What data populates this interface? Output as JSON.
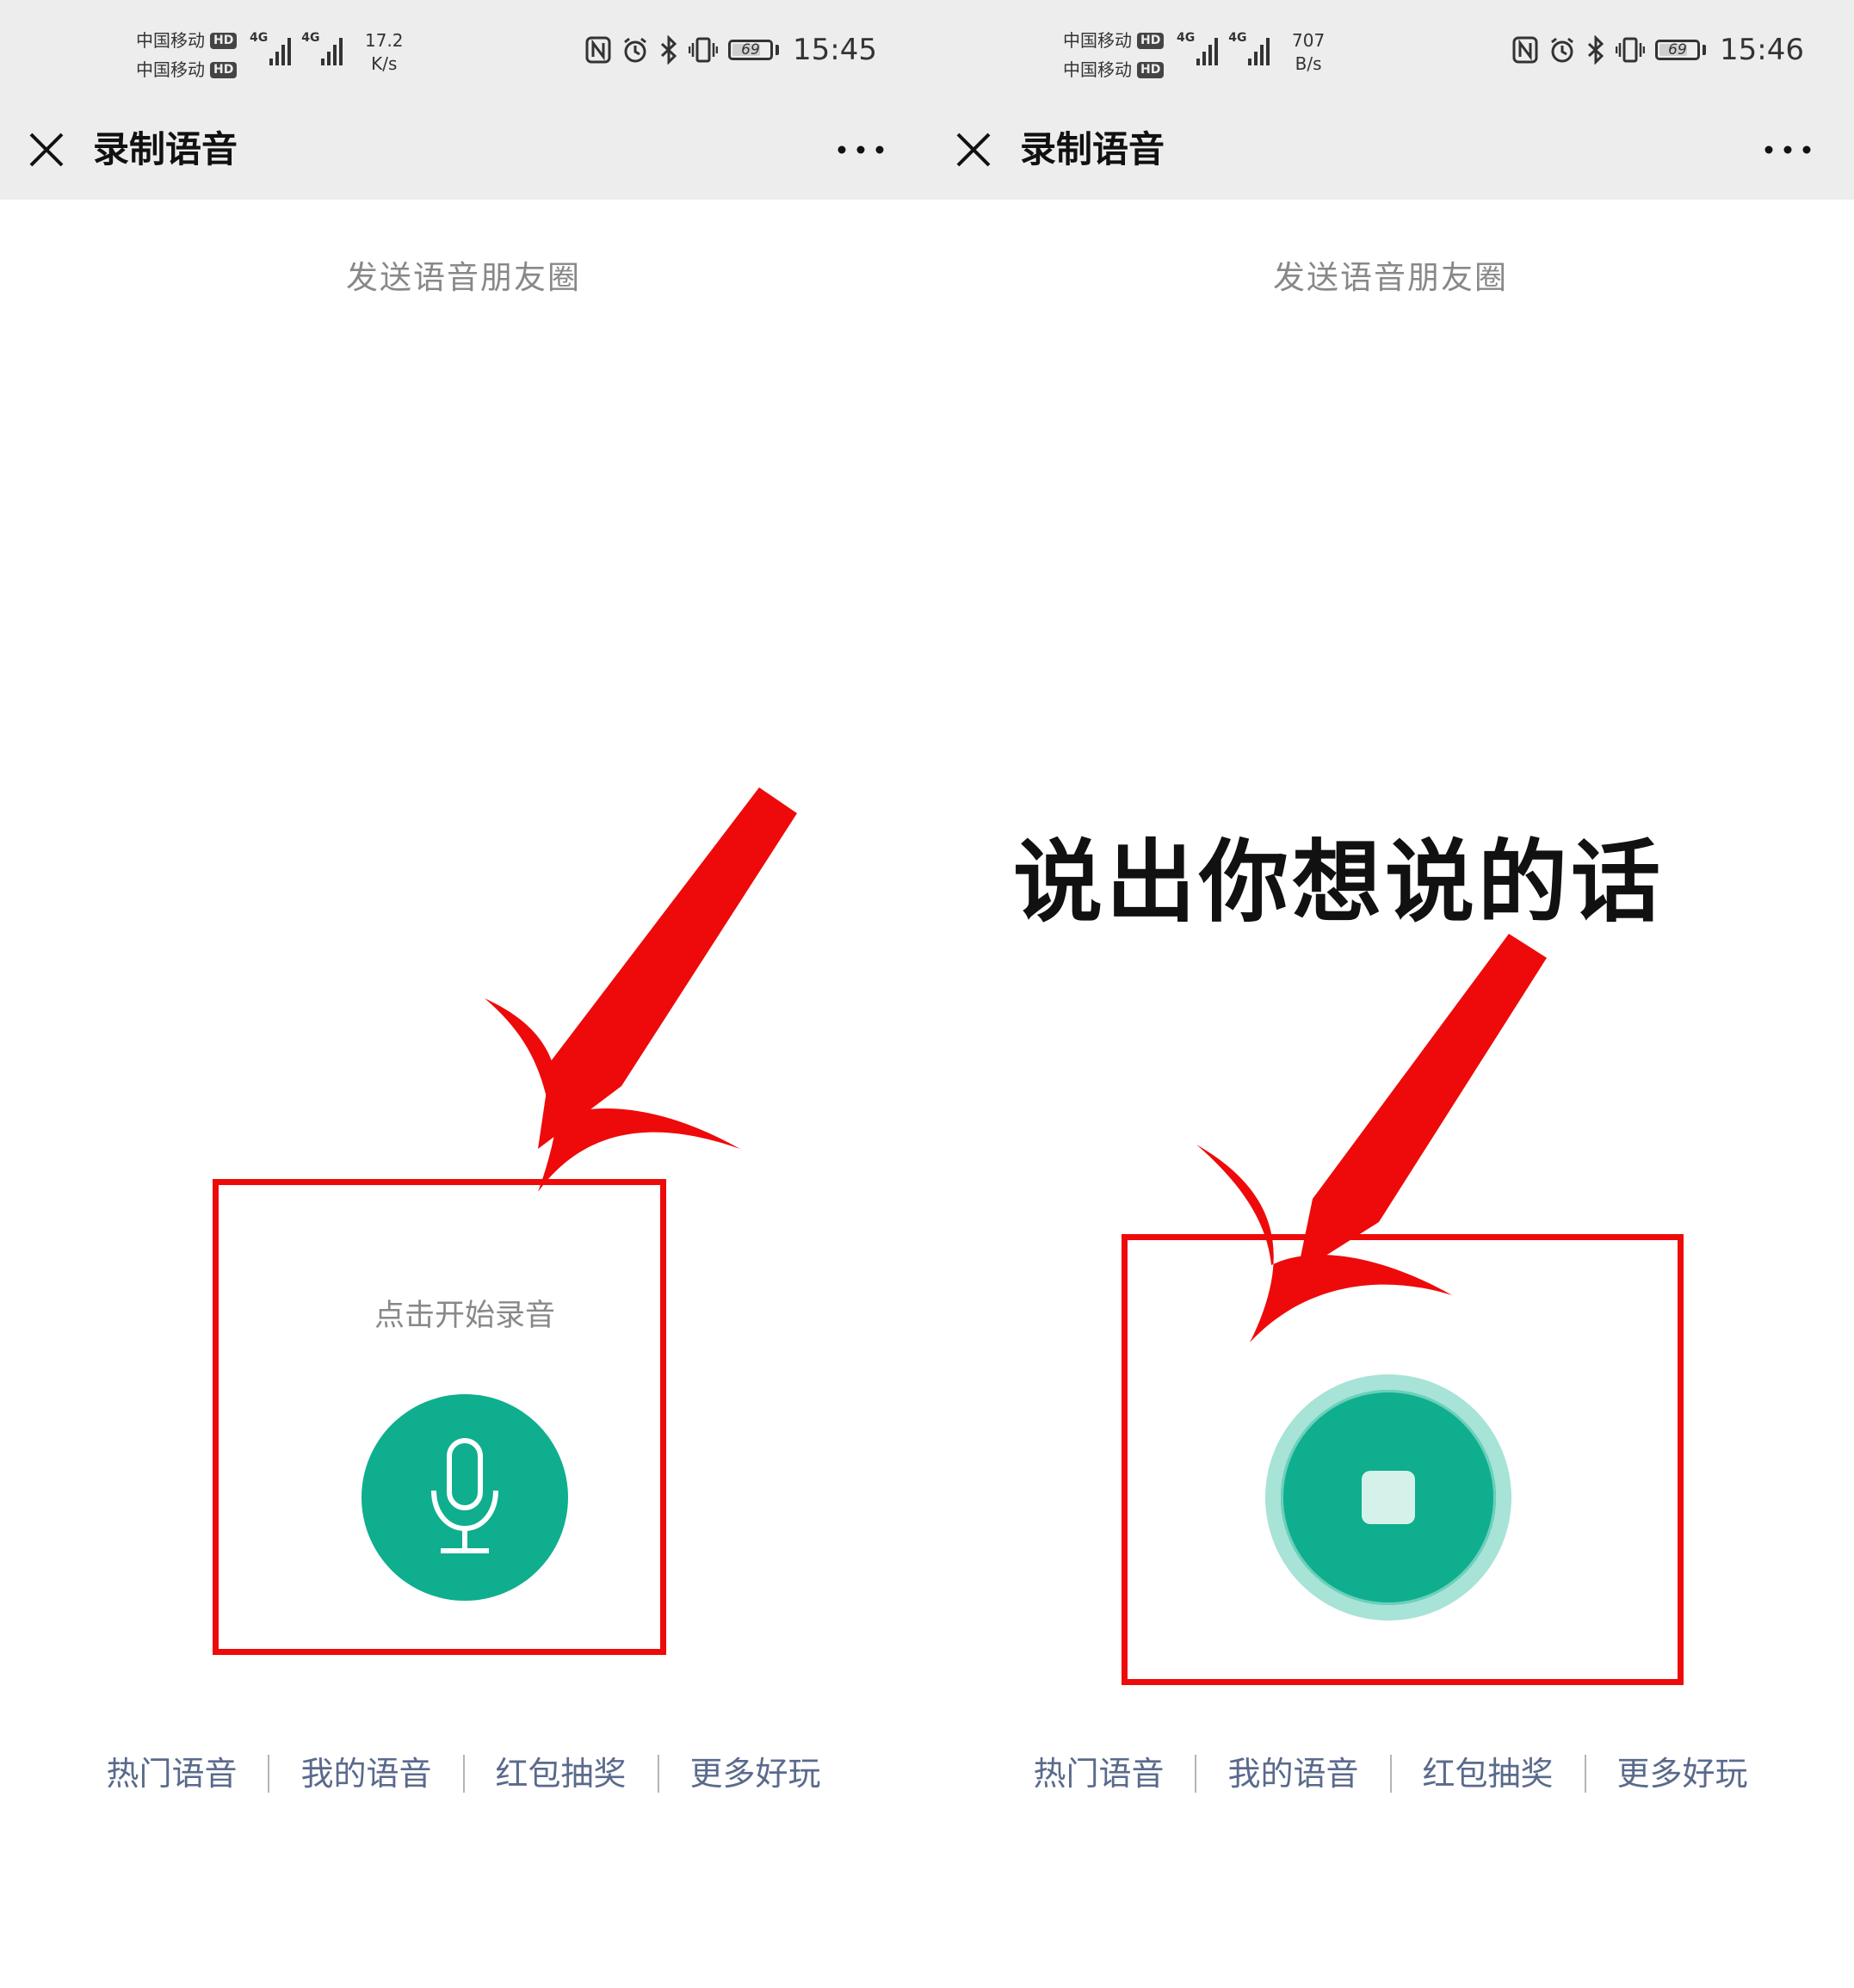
{
  "screens": [
    {
      "status": {
        "carrier1": "中国移动",
        "carrier2": "中国移动",
        "hd_badge": "HD",
        "network_tag": "4G",
        "net_speed_value": "17.2",
        "net_speed_unit": "K/s",
        "battery": "69",
        "time": "15:45"
      },
      "nav": {
        "title": "录制语音",
        "close_icon": "close-icon",
        "more_icon": "more-dots-icon"
      },
      "subtitle": "发送语音朋友圈",
      "hint": "点击开始录音",
      "record_icon": "microphone-icon",
      "links": [
        "热门语音",
        "我的语音",
        "红包抽奖",
        "更多好玩"
      ]
    },
    {
      "status": {
        "carrier1": "中国移动",
        "carrier2": "中国移动",
        "hd_badge": "HD",
        "network_tag": "4G",
        "net_speed_value": "707",
        "net_speed_unit": "B/s",
        "battery": "69",
        "time": "15:46"
      },
      "nav": {
        "title": "录制语音",
        "close_icon": "close-icon",
        "more_icon": "more-dots-icon"
      },
      "subtitle": "发送语音朋友圈",
      "record_icon": "stop-icon",
      "caption": "说出你想说的话",
      "links": [
        "热门语音",
        "我的语音",
        "红包抽奖",
        "更多好玩"
      ]
    }
  ],
  "colors": {
    "accent_green": "#0fae8e",
    "annotation_red": "#ee0a0a",
    "bar_background": "#ededed",
    "link_color": "#5a6a8c"
  }
}
